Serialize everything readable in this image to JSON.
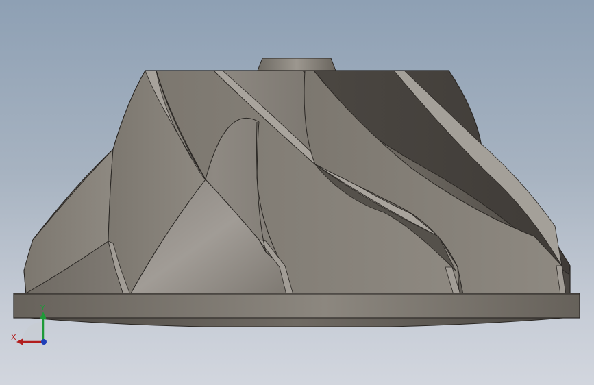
{
  "viewport": {
    "background_top": "#8ea0b4",
    "background_bottom": "#d2d6de",
    "model": "impeller-side-view"
  },
  "triad": {
    "x_label": "X",
    "y_label": "Y",
    "x_color": "#b21d1d",
    "y_color": "#1e9a38",
    "z_color": "#1f3fb8"
  }
}
